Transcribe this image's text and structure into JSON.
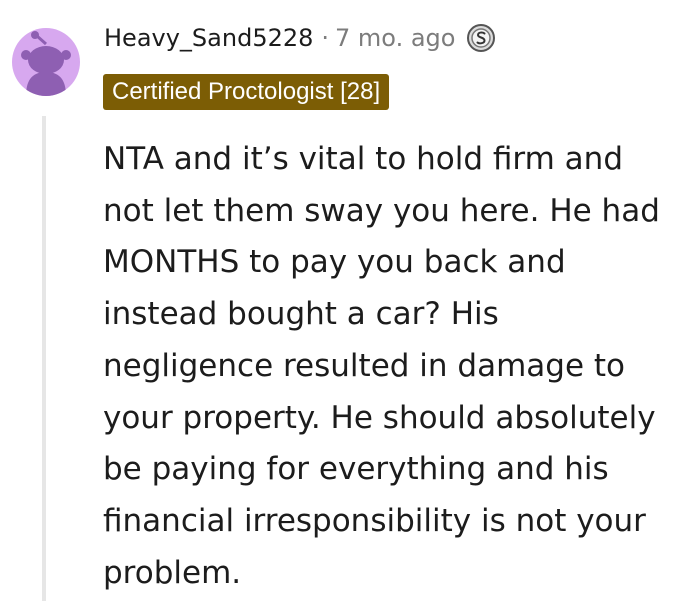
{
  "comment": {
    "author": "Heavy_Sand5228",
    "separator": "·",
    "timestamp": "7 mo. ago",
    "award_icon": "silver-award-icon",
    "flair": "Certified Proctologist [28]",
    "body_lines": [
      "NTA and it’s vital to hold firm and",
      "not let them sway you here. He had",
      "MONTHS to pay you back and",
      "instead bought a car? His",
      "negligence resulted in damage to",
      "your property. He should absolutely",
      "be paying for everything and his",
      "financial irresponsibility is not your",
      "problem."
    ]
  },
  "colors": {
    "avatar_background": "#d7a8ef",
    "avatar_figure": "#8e5fb2",
    "flair_background": "#7c5d05",
    "flair_text": "#ffffff",
    "text": "#1c1c1c",
    "meta_text": "#7c7c7c",
    "thread_line": "#e6e6e6"
  }
}
